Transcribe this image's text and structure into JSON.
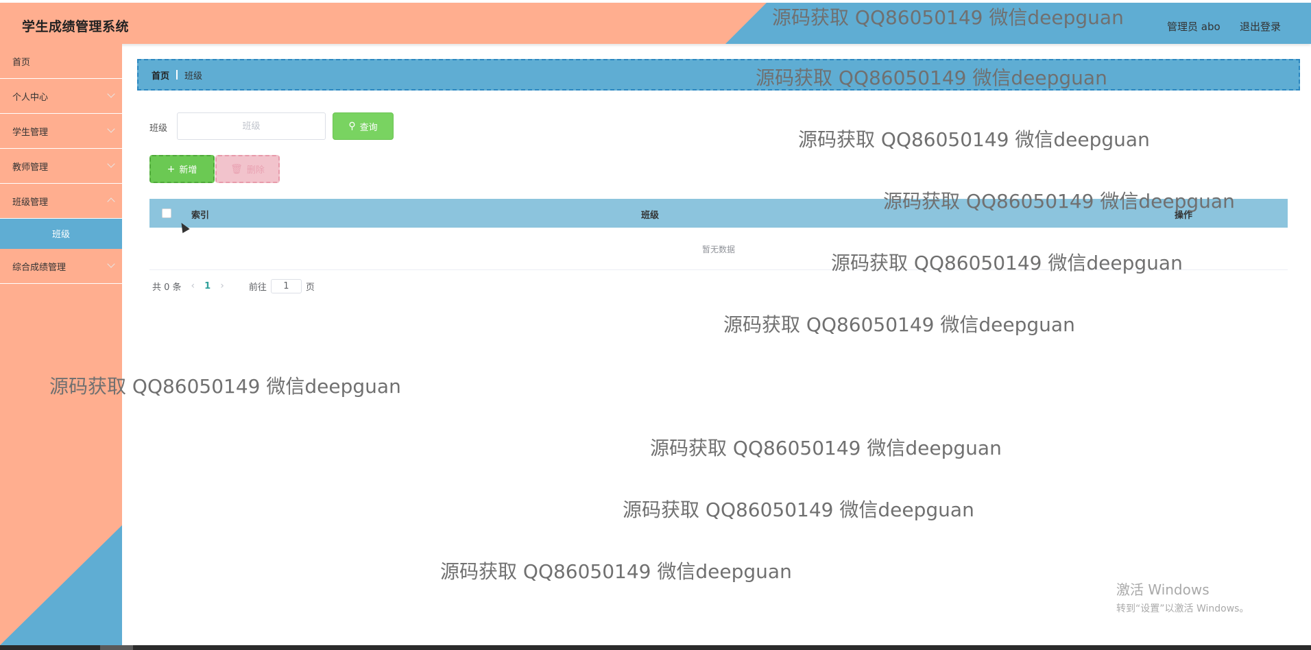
{
  "header": {
    "app_title": "学生成绩管理系统",
    "user_label": "管理员 abo",
    "logout_label": "退出登录"
  },
  "sidebar": {
    "items": [
      {
        "label": "首页"
      },
      {
        "label": "个人中心"
      },
      {
        "label": "学生管理"
      },
      {
        "label": "教师管理"
      },
      {
        "label": "班级管理"
      },
      {
        "label": "综合成绩管理"
      }
    ],
    "active_sub_item": "班级"
  },
  "breadcrumb": {
    "home": "首页",
    "current": "班级"
  },
  "search": {
    "label": "班级",
    "placeholder": "班级",
    "button_label": "查询"
  },
  "actions": {
    "add_label": "新增",
    "delete_label": "删除"
  },
  "table": {
    "columns": [
      "索引",
      "班级",
      "操作"
    ],
    "rows": [],
    "empty_text": "暂无数据"
  },
  "pagination": {
    "total_text": "共 0 条",
    "current_page": "1",
    "goto_prefix": "前往",
    "goto_value": "1",
    "goto_suffix": "页"
  },
  "watermark_text": "源码获取 QQ86050149 微信deepguan",
  "windows_activation": {
    "title": "激活 Windows",
    "subtitle": "转到“设置”以激活 Windows。"
  },
  "colors": {
    "salmon": "#ffae8f",
    "blue": "#5fadd3",
    "table_header": "#8cc4dd",
    "success": "#79d361",
    "danger_light": "#f2c3cc",
    "page_active": "#2fa09a"
  }
}
